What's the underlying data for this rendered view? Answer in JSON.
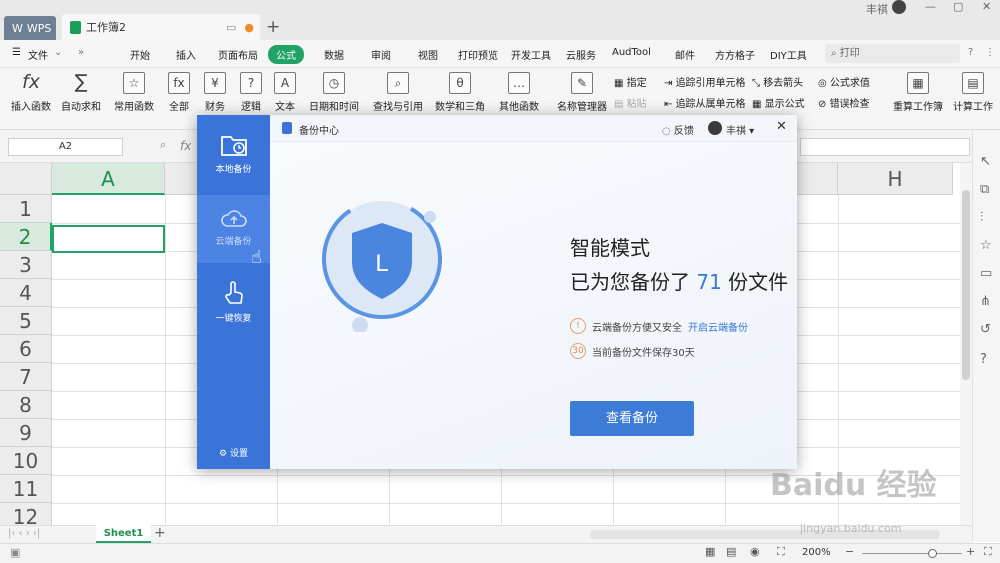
{
  "titlebar": {
    "wps_tab": "WPS",
    "book_tab": "工作簿2",
    "user": "丰祺"
  },
  "menubar": {
    "items": [
      "文件",
      "开始",
      "插入",
      "页面布局",
      "公式",
      "数据",
      "审阅",
      "视图",
      "打印预览",
      "开发工具",
      "云服务",
      "AudTool",
      "邮件",
      "方方格子",
      "DIY工具"
    ],
    "active": "公式",
    "search": "打印"
  },
  "ribbon": {
    "buttons": [
      "插入函数",
      "自动求和",
      "常用函数",
      "全部",
      "财务",
      "逻辑",
      "文本",
      "日期和时间",
      "查找与引用",
      "数学和三角",
      "其他函数",
      "名称管理器",
      "重算工作簿",
      "计算工作"
    ],
    "small": [
      "指定",
      "粘贴",
      "追踪引用单元格",
      "追踪从属单元格",
      "移去箭头",
      "显示公式",
      "公式求值",
      "错误检查"
    ]
  },
  "formula_bar": {
    "name_box": "A2",
    "fx": "fx"
  },
  "grid": {
    "columns": [
      "A",
      "H"
    ],
    "rows": [
      "1",
      "2",
      "3",
      "4",
      "5",
      "6",
      "7",
      "8",
      "9",
      "10",
      "11",
      "12"
    ],
    "selected_col": "A",
    "selected_row": "2"
  },
  "sheets": {
    "tabs": [
      "Sheet1"
    ],
    "add": "+"
  },
  "status": {
    "zoom": "200%"
  },
  "dialog": {
    "title": "备份中心",
    "feedback": "反馈",
    "user": "丰祺",
    "sidebar": [
      "本地备份",
      "云端备份",
      "一键恢复"
    ],
    "settings": "设置",
    "mode_title": "智能模式",
    "sub_prefix": "已为您备份了",
    "count": "71",
    "sub_suffix": "份文件",
    "tip1": "云端备份方便又安全",
    "tip1_link": "开启云端备份",
    "tip2": "当前备份文件保存30天",
    "tip2_icon": "30",
    "button": "查看备份",
    "shield_letter": "L"
  },
  "watermark": "Baidu 经验",
  "watermark_url": "jingyan.baidu.com"
}
